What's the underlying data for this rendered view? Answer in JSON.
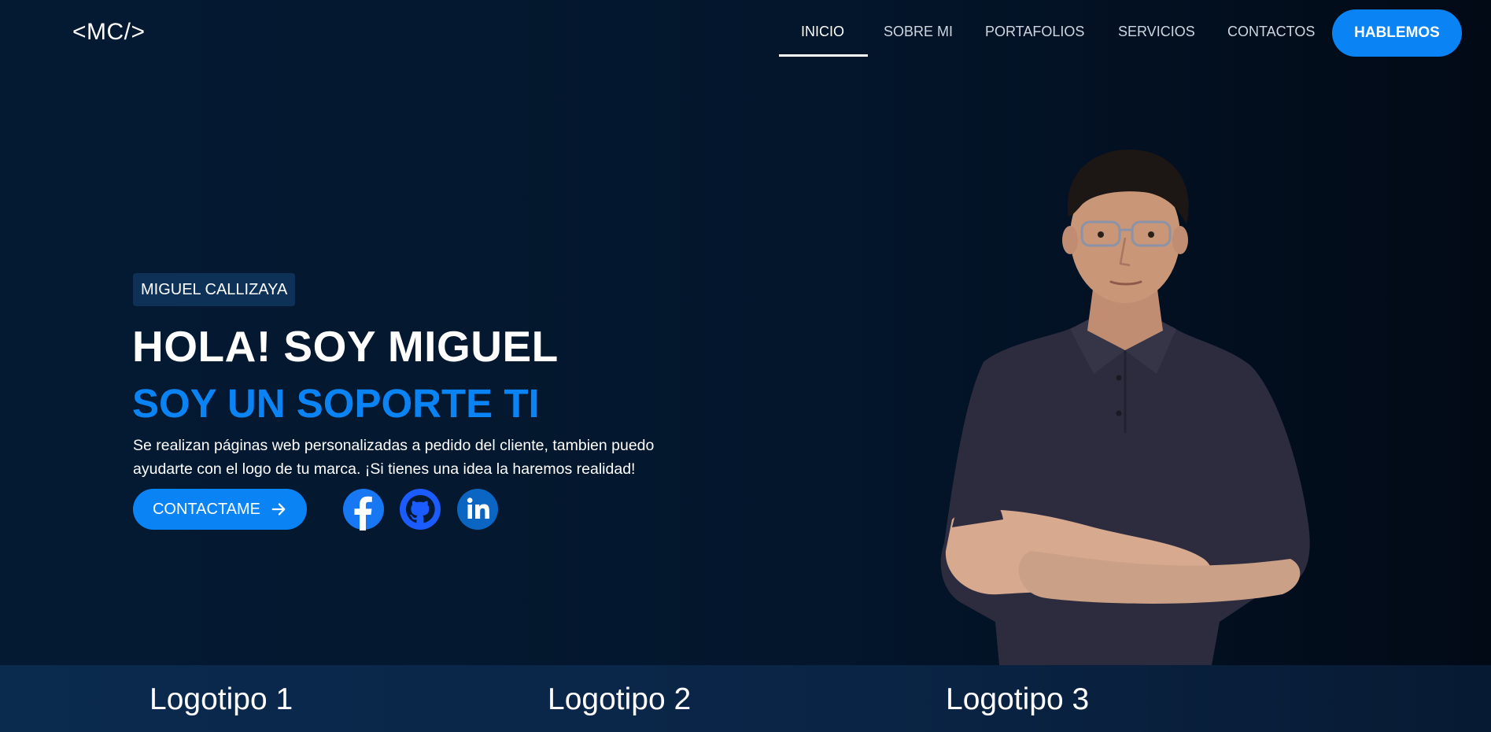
{
  "brand": {
    "logo_text": "<MC/>"
  },
  "nav": {
    "items": [
      {
        "label": "INICIO",
        "active": true
      },
      {
        "label": "SOBRE MI",
        "active": false
      },
      {
        "label": "PORTAFOLIOS",
        "active": false
      },
      {
        "label": "SERVICIOS",
        "active": false
      },
      {
        "label": "CONTACTOS",
        "active": false
      }
    ],
    "cta_label": "HABLEMOS"
  },
  "hero": {
    "name_badge": "MIGUEL CALLIZAYA",
    "headline": "HOLA! SOY MIGUEL",
    "subheadline": "SOY UN SOPORTE TI",
    "description": "Se realizan páginas web personalizadas a pedido del cliente, tambien puedo ayudarte con el logo de tu marca. ¡Si tienes una idea la haremos realidad!",
    "contact_button": "CONTACTAME",
    "contact_button_icon": "arrow-right-icon",
    "social_links": [
      {
        "icon": "facebook-icon",
        "color": "#1877f2"
      },
      {
        "icon": "github-icon",
        "color": "#1a5cff"
      },
      {
        "icon": "linkedin-icon",
        "color": "#0a66c2"
      }
    ]
  },
  "logos": [
    "Logotipo 1",
    "Logotipo 2",
    "Logotipo 3"
  ],
  "colors": {
    "accent": "#0a84f5",
    "background_dark": "#03162c",
    "badge_bg": "#0d3157"
  }
}
